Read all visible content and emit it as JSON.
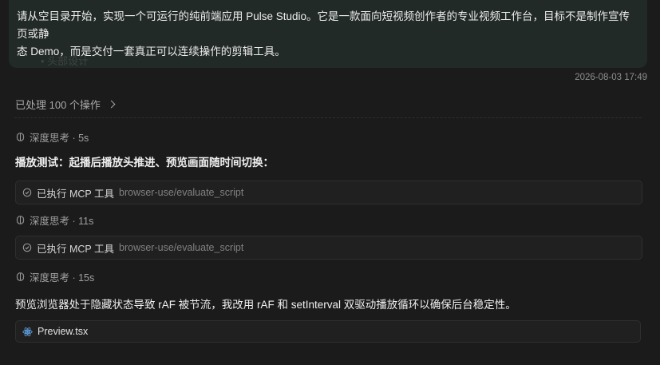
{
  "user_message": {
    "line1": "请从空目录开始，实现一个可运行的纯前端应用 Pulse Studio。它是一款面向短视频创作者的专业视频工作台，目标不是制作宣传页或静",
    "line2": "态 Demo，而是交付一套真正可以连续操作的剪辑工具。",
    "ghost": "• 头部设计"
  },
  "timestamp": "2026-08-03 17:49",
  "processed": "已处理 100 个操作",
  "steps": {
    "think1": "深度思考 · 5s",
    "para1": "播放测试：起播后播放头推进、预览画面随时间切换：",
    "tool1_label": "已执行 MCP 工具",
    "tool1_name": "browser-use/evaluate_script",
    "think2": "深度思考 · 11s",
    "tool2_label": "已执行 MCP 工具",
    "tool2_name": "browser-use/evaluate_script",
    "think3": "深度思考 · 15s",
    "para2": "预览浏览器处于隐藏状态导致 rAF 被节流，我改用 rAF 和 setInterval 双驱动播放循环以确保后台稳定性。",
    "file": "Preview.tsx"
  },
  "colors": {
    "bubble": "#222a27",
    "background": "#1b1b1b",
    "react": "#61a6e6"
  }
}
